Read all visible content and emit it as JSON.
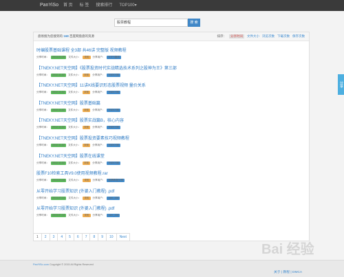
{
  "nav": {
    "brand": "PanYiSo",
    "links": [
      "首 页",
      "标 签",
      "搜索排行",
      "TOP100▾"
    ]
  },
  "search": {
    "value": "股票教程",
    "button": "搜 索"
  },
  "summary": {
    "prefix": "盘易搜为您搜到的",
    "count": "168",
    "suffix": "百度网盘盘的资源"
  },
  "sort": {
    "label": "排序：",
    "options": [
      "分享时间",
      "文件大小",
      "浏览次数",
      "下载次数",
      "保存次数"
    ]
  },
  "items": [
    {
      "title": "时编股票基础课程 全3部 共46讲 完整版 视频教程",
      "meta": [
        "分享时间：",
        "2013-01-05",
        "文件大小：",
        "未知",
        "分享用户：",
        "NTFS搬砖"
      ]
    },
    {
      "title": "【TNEKY.NET天空网】《股票投资时代实战精选技术系列之股神为王》第三部",
      "meta": [
        "分享时间：",
        "2012-11-02",
        "文件大小：",
        "未知",
        "分享用户：",
        "TNEKY网"
      ]
    },
    {
      "title": "【TNEKY.NET天空网】11讲K线要识形态股票视频 量价关系",
      "meta": [
        "分享时间：",
        "2012-11-02",
        "文件大小：",
        "未知",
        "分享用户：",
        "TNEKY网"
      ]
    },
    {
      "title": "【TNEKY.NET天空网】股票基础篇",
      "meta": [
        "分享时间：",
        "2012-11-02",
        "文件大小：",
        "未知",
        "分享用户：",
        "TNEKY网"
      ]
    },
    {
      "title": "【TNEKY.NET天空网】股票实战篇B，核心内容",
      "meta": [
        "分享时间：",
        "2012-11-02",
        "文件大小：",
        "未知",
        "分享用户：",
        "TNEKY网"
      ]
    },
    {
      "title": "【TNEKY.NET天空网】股票投资要素技巧视频教程",
      "meta": [
        "分享时间：",
        "2012-11-02",
        "文件大小：",
        "未知",
        "分享用户：",
        "TNEKY网"
      ]
    },
    {
      "title": "【TNEKY.NET天空网】股票在线课堂",
      "meta": [
        "分享时间：",
        "2012-11-02",
        "文件大小：",
        "未知",
        "分享用户：",
        "TNEKY网"
      ]
    },
    {
      "title": "股票F10检索工具V9.0使用视频教程.rar",
      "meta": [
        "分享时间：",
        "2013-07-14",
        "文件大小：",
        "未知",
        "分享用户：",
        "股票教程分享"
      ]
    },
    {
      "title": "从零开始学习股票知识 (外婆入门教程) .pdf",
      "meta": [
        "分享时间：",
        "2013-07-14",
        "文件大小：",
        "未知",
        "分享用户：",
        "user_168"
      ]
    },
    {
      "title": "从零开始学习股票知识 (外婆入门教程) .pdf",
      "meta": [
        "分享时间：",
        "2013-07-14",
        "文件大小：",
        "未知",
        "分享用户：",
        "user_168"
      ]
    }
  ],
  "pager": [
    "1",
    "2",
    "3",
    "4",
    "5",
    "6",
    "7",
    "8",
    "9",
    "10",
    "Next"
  ],
  "footer": {
    "site": "PanYiSo.com",
    "copyright": "Copyright © 2015 All Rights Reserved",
    "links": "关于 | 教程 | DMCA"
  },
  "side_tab": "分享",
  "colors": {
    "accent": "#3c8ad0",
    "nav_bg": "#3a3a3a",
    "badge_time": "#5cb85c",
    "badge_size": "#f0ad4e",
    "badge_user": "#428bca"
  }
}
